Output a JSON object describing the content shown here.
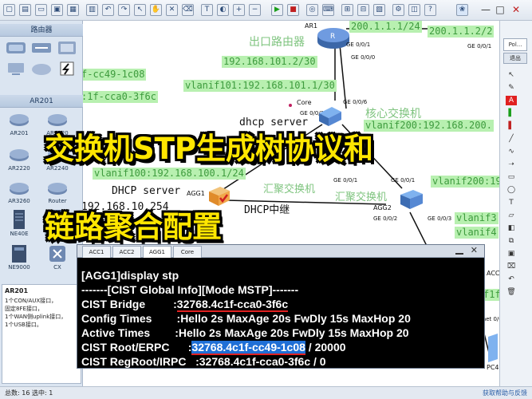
{
  "toolbar": {
    "window_controls": [
      "—",
      "□",
      "✕"
    ]
  },
  "left_panel": {
    "header_routers": "路由器",
    "header_ar201": "AR201",
    "devices": [
      "AR201",
      "AR1220",
      "AR2220",
      "AR2240",
      "AR3260",
      "Router",
      "NE40E",
      "NE5000E",
      "NE9000",
      "CX"
    ],
    "info_title": "AR201",
    "info_text": [
      "1个CON/AUX接口，",
      "固定8FE接口，",
      "1个WAN侧uplink接口，",
      "1个USB接口。"
    ]
  },
  "right_panel": {
    "thumb_label": "Pol...",
    "exit_label": "退出"
  },
  "canvas": {
    "ar1": "AR1",
    "ip_200_1": "200.1.1.1/24",
    "ip_200_2": "200.1.1.2/2",
    "exit_router": "出口路由器",
    "ge001_top": "GE 0/0/1",
    "ge000": "GE 0/0/0",
    "ge001_r": "GE 0/0/1",
    "ip_101_2": "192.168.101.2/30",
    "vlanif101": "vlanif101:192.168.101.1/30",
    "mac_left_1": "f-cc49-1c08",
    "mac_left_2": ":1f-cca0-3f6c",
    "core": "Core",
    "ge003": "GE 0/0/3",
    "ge006": "GE 0/0/6",
    "core_switch": "核心交换机",
    "dhcp_server_top": "dhcp server",
    "vlanif200": "vlanif200:192.168.200.",
    "vlanif100": "vlanif100:192.168.100.1/24",
    "dhcp_server_mid": "DHCP server",
    "agg1": "AGG1",
    "agg_switch_1": "汇聚交换机",
    "agg_switch_2": "汇聚交换机",
    "ge001_agg": "GE 0/0/1",
    "ge001_agg2": "GE 0/0/1",
    "vlanif2_right": "vlanif200:19",
    "ip_10_254": "192.168.10.254",
    "dhcp_relay": "DHCP中继",
    "agg2": "AGG2",
    "ge002": "GE 0/0/2",
    "ge003_b": "GE 0/0/3",
    "vlanif3_right": "vlanif3",
    "vlanif4_right": "vlanif4",
    "acc4": "ACC4",
    "mac_right": "f1f-cc9",
    "ethernet": "rnet 0/0/1",
    "pc4": "PC4"
  },
  "overlay": {
    "line1": "交换机STP生成树协议和",
    "line2": "链路聚合配置"
  },
  "terminal": {
    "small_label": "AGG1",
    "tabs": [
      "ACC1",
      "ACC2",
      "AGG1",
      "Core"
    ],
    "active_tab": "AGG1",
    "line1": "[AGG1]display stp",
    "line2": "-------[CIST Global Info][Mode MSTP]-------",
    "line3_key": "CIST Bridge         :",
    "line3_val": "32768.4c1f-cca0-3f6c",
    "line4": "Config Times        :Hello 2s MaxAge 20s FwDly 15s MaxHop 20",
    "line5": "Active Times        :Hello 2s MaxAge 20s FwDly 15s MaxHop 20",
    "line6_key": "CIST Root/ERPC      :",
    "line6_sel": "32768.4c1f-cc49-1c08",
    "line6_rest": " / 20000",
    "line7": "CIST RegRoot/IRPC   :32768.4c1f-cca0-3f6c / 0"
  },
  "status": {
    "left": "总数: 16  选中: 1",
    "right": "获取帮助与反馈"
  },
  "colors": {
    "highlight_bg": "#b8f0b0",
    "highlight_text": "#3d9b3d",
    "overlay_yellow": "#ffe600",
    "terminal_bg": "#000000",
    "selection": "#1f6fd6",
    "underline_red": "#e02020"
  }
}
